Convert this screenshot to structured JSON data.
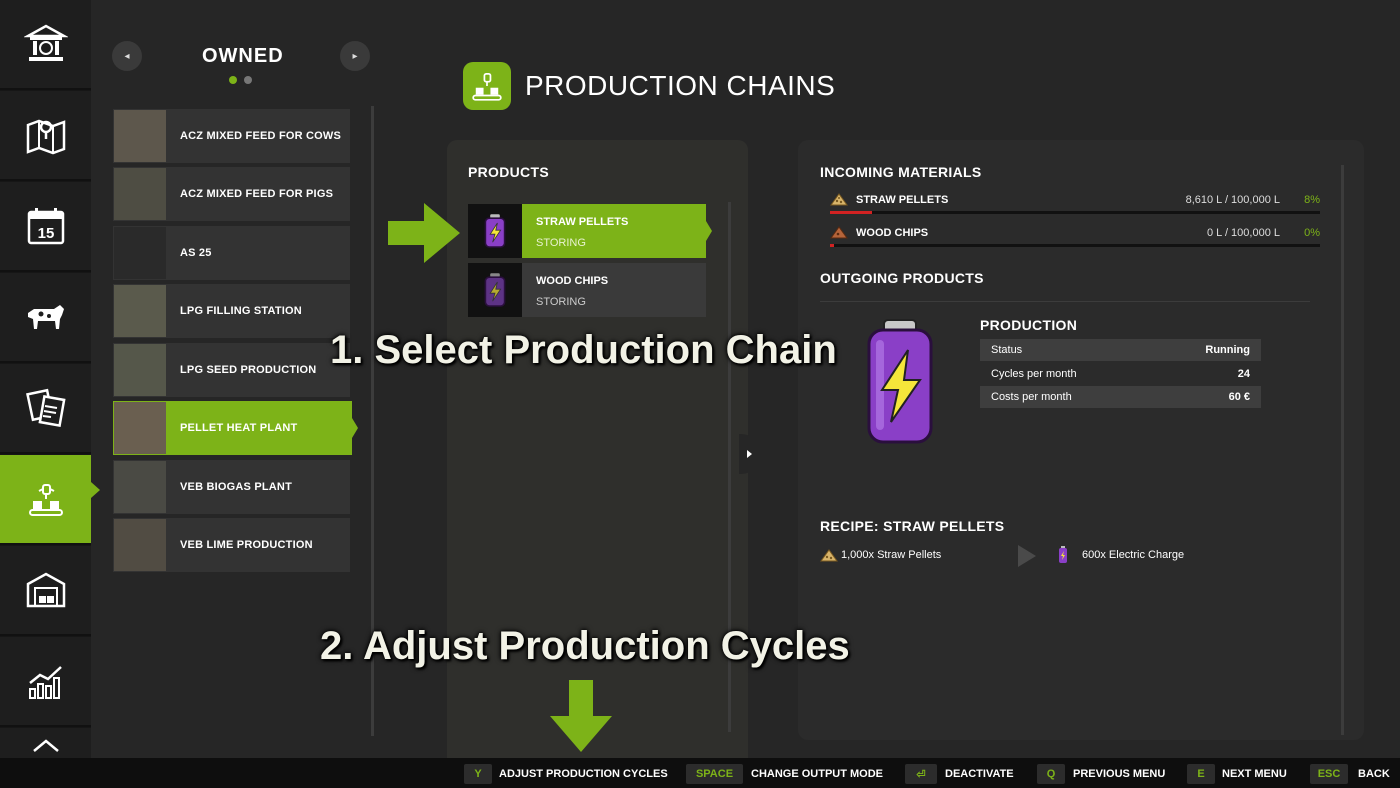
{
  "sidebar": {
    "items": [
      {
        "icon": "bank-icon"
      },
      {
        "icon": "map-icon"
      },
      {
        "icon": "calendar-icon",
        "day": "15"
      },
      {
        "icon": "cow-icon"
      },
      {
        "icon": "contracts-icon"
      },
      {
        "icon": "production-icon"
      },
      {
        "icon": "warehouse-icon"
      },
      {
        "icon": "statistics-icon"
      }
    ]
  },
  "owned": {
    "title": "OWNED",
    "prev_label": "◂",
    "next_label": "▸",
    "items": [
      {
        "label": "ACZ MIXED FEED FOR COWS"
      },
      {
        "label": "ACZ MIXED FEED FOR PIGS"
      },
      {
        "label": "AS 25"
      },
      {
        "label": "LPG FILLING STATION"
      },
      {
        "label": "LPG SEED PRODUCTION"
      },
      {
        "label": "PELLET HEAT PLANT"
      },
      {
        "label": "VEB BIOGAS PLANT"
      },
      {
        "label": "VEB LIME PRODUCTION"
      }
    ]
  },
  "header": {
    "title": "PRODUCTION CHAINS"
  },
  "products": {
    "title": "PRODUCTS",
    "items": [
      {
        "name": "STRAW PELLETS",
        "status": "STORING"
      },
      {
        "name": "WOOD CHIPS",
        "status": "STORING"
      }
    ]
  },
  "incoming": {
    "title": "INCOMING MATERIALS",
    "rows": [
      {
        "name": "STRAW PELLETS",
        "amount": "8,610 L / 100,000 L",
        "percent": "8%",
        "fill": 0.086
      },
      {
        "name": "WOOD CHIPS",
        "amount": "0 L / 100,000 L",
        "percent": "0%",
        "fill": 0.0
      }
    ]
  },
  "outgoing": {
    "title": "OUTGOING PRODUCTS",
    "production_title": "PRODUCTION",
    "rows": [
      {
        "label": "Status",
        "value": "Running"
      },
      {
        "label": "Cycles per month",
        "value": "24"
      },
      {
        "label": "Costs per month",
        "value": "60 €"
      }
    ]
  },
  "recipe": {
    "title": "RECIPE: STRAW PELLETS",
    "input": "1,000x Straw Pellets",
    "output": "600x Electric Charge"
  },
  "annotations": {
    "step1": "1. Select Production Chain",
    "step2": "2. Adjust Production Cycles"
  },
  "footer": {
    "items": [
      {
        "key": "Y",
        "label": "ADJUST PRODUCTION CYCLES"
      },
      {
        "key": "SPACE",
        "label": "CHANGE OUTPUT MODE"
      },
      {
        "key": "⏎",
        "label": "DEACTIVATE"
      },
      {
        "key": "Q",
        "label": "PREVIOUS MENU"
      },
      {
        "key": "E",
        "label": "NEXT MENU"
      },
      {
        "key": "ESC",
        "label": "BACK"
      }
    ]
  },
  "colors": {
    "accent": "#7db318",
    "warning": "#d22222",
    "battery": "#8a3fc7"
  }
}
